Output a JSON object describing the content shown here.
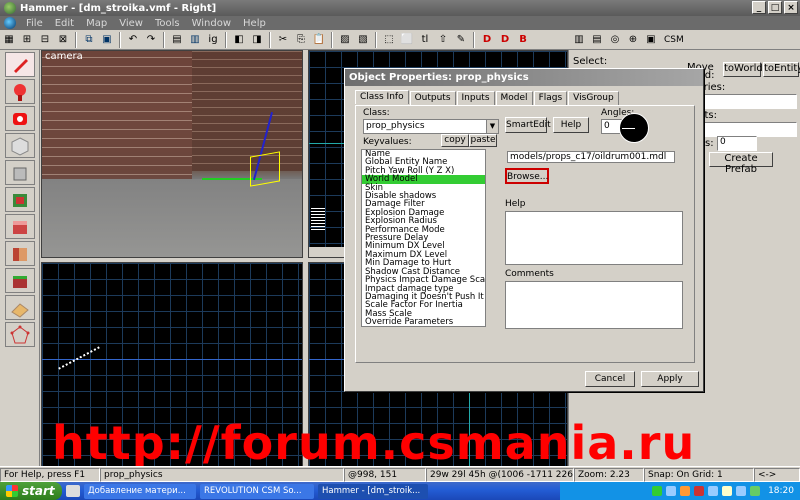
{
  "window": {
    "title": "Hammer - [dm_stroika.vmf - Right]",
    "controls": [
      "_",
      "□",
      "×"
    ]
  },
  "menu": [
    "File",
    "Edit",
    "Map",
    "View",
    "Tools",
    "Window",
    "Help"
  ],
  "toolbar": {
    "ig_label": "ig",
    "csm_label": "CSM"
  },
  "sidebar": {
    "select_label": "Select:",
    "move_label": "Move",
    "selected_label": "ected:",
    "to_world": "toWorld",
    "to_entity": "toEntity",
    "categories_label": "egories:",
    "objects_label": "cts:",
    "faces_label": "s:",
    "faces_value": "0",
    "create_prefab": "Create Prefab"
  },
  "viewports": {
    "camera_label": "camera"
  },
  "dialog": {
    "title": "Object Properties: prop_physics",
    "tabs": [
      "Class Info",
      "Outputs",
      "Inputs",
      "Model",
      "Flags",
      "VisGroup"
    ],
    "class_label": "Class:",
    "class_value": "prop_physics",
    "smartedit": "SmartEdit",
    "help_button": "Help",
    "angles_label": "Angles:",
    "angles_value": "0",
    "keyvalues_label": "Keyvalues:",
    "copy": "copy",
    "paste": "paste",
    "keyvalues": [
      "Name",
      "Global Entity Name",
      "Pitch Yaw Roll (Y Z X)",
      "World Model",
      "Skin",
      "Disable shadows",
      "Damage Filter",
      "Explosion Damage",
      "Explosion Radius",
      "Performance Mode",
      "Pressure Delay",
      "Minimum DX Level",
      "Maximum DX Level",
      "Min Damage to Hurt",
      "Shadow Cast Distance",
      "Physics Impact Damage Scale",
      "Impact damage type",
      "Damaging it Doesn't Push It",
      "Scale Factor For Inertia",
      "Mass Scale",
      "Override Parameters"
    ],
    "selected_key": "World Model",
    "model_path": "models/props_c17/oildrum001.mdl",
    "browse": "Browse...",
    "help_section": "Help",
    "comments_section": "Comments",
    "cancel": "Cancel",
    "apply": "Apply"
  },
  "watermark": "http://forum.csmania.ru",
  "status": {
    "help": "For Help, press F1",
    "entity": "prop_physics",
    "coords": "@998, 151",
    "bounds": "29w 29l 45h @(1006 -1711 226)",
    "zoom": "Zoom: 2.23",
    "snap": "Snap: On Grid: 1",
    "nav": "<->"
  },
  "taskbar": {
    "start": "start",
    "tasks": [
      {
        "label": "Добавление матери..."
      },
      {
        "label": "REVOLUTION CSM So..."
      },
      {
        "label": "Hammer - [dm_stroik..."
      }
    ],
    "clock": "18:20"
  },
  "colors": {
    "selected_key_bg": "#33cc33",
    "watermark": "#ff0000",
    "taskbar": "#245ed6",
    "browse_outline": "#cc0000"
  }
}
